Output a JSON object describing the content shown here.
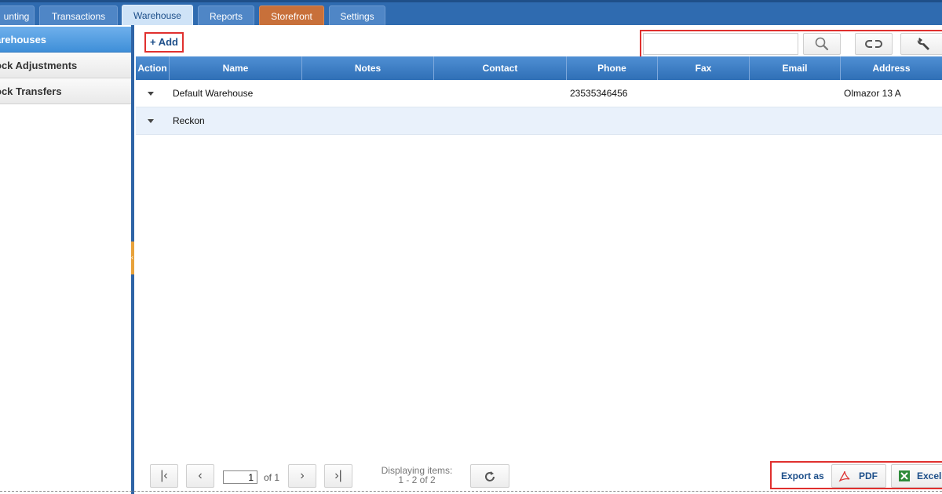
{
  "tabs": [
    {
      "label": "unting"
    },
    {
      "label": "Transactions"
    },
    {
      "label": "Warehouse"
    },
    {
      "label": "Reports"
    },
    {
      "label": "Storefront"
    },
    {
      "label": "Settings"
    }
  ],
  "sidebar": {
    "items": [
      {
        "label": "arehouses"
      },
      {
        "label": "ock Adjustments"
      },
      {
        "label": "ock Transfers"
      }
    ]
  },
  "toolbar": {
    "add_label": "+ Add",
    "search_placeholder": ""
  },
  "grid": {
    "columns": [
      "Action",
      "Name",
      "Notes",
      "Contact",
      "Phone",
      "Fax",
      "Email",
      "Address"
    ],
    "rows": [
      {
        "name": "Default Warehouse",
        "notes": "",
        "contact": "",
        "phone": "23535346456",
        "fax": "",
        "email": "",
        "address": "Olmazor 13 A"
      },
      {
        "name": "Reckon",
        "notes": "",
        "contact": "",
        "phone": "",
        "fax": "",
        "email": "",
        "address": ""
      }
    ]
  },
  "pager": {
    "page": "1",
    "of_label": "of",
    "total_pages": "1",
    "displaying_label": "Displaying items:",
    "range": "1 - 2 of 2"
  },
  "export": {
    "label": "Export as",
    "pdf_label": "PDF",
    "excel_label": "Excel"
  },
  "colors": {
    "accent": "#2f6bb0",
    "highlight": "#e0302e",
    "storefront_tab": "#c8703a"
  }
}
